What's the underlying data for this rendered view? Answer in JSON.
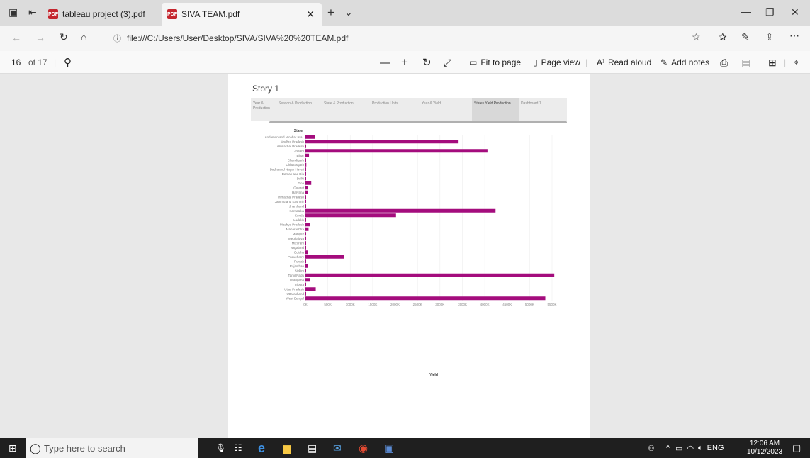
{
  "tabs": [
    {
      "label": "tableau project (3).pdf",
      "active": false
    },
    {
      "label": "SIVA TEAM.pdf",
      "active": true
    }
  ],
  "address": "file:///C:/Users/User/Desktop/SIVA/SIVA%20%20TEAM.pdf",
  "toolbar": {
    "page_number": "16",
    "page_total": "of 17",
    "fit_to_page": "Fit to page",
    "page_view": "Page view",
    "read_aloud": "Read aloud",
    "add_notes": "Add notes"
  },
  "story": {
    "title": "Story 1",
    "nav": [
      "Year & Production",
      "Season & Production",
      "State & Production",
      "Production Units",
      "Year & Yield",
      "States Yield Production",
      "Dashboard 1"
    ],
    "selected_index": 5
  },
  "chart_data": {
    "type": "bar",
    "orientation": "horizontal",
    "title": "",
    "ylabel": "State",
    "xlabel": "Yield",
    "xlim": [
      0,
      5500000
    ],
    "tick_labels": [
      "0K",
      "500K",
      "1000K",
      "1500K",
      "2000K",
      "2500K",
      "3000K",
      "3500K",
      "4000K",
      "4500K",
      "5000K",
      "5500K"
    ],
    "bar_color": "#a40c7d",
    "categories": [
      "Andaman and Nicobar Isla..",
      "Andhra Pradesh",
      "Arunachal Pradesh",
      "Assam",
      "Bihar",
      "Chandigarh",
      "Chhattisgarh",
      "Dadra and Nagar Haveli",
      "Daman and Diu",
      "Delhi",
      "Goa",
      "Gujarat",
      "Haryana",
      "Himachal Pradesh",
      "Jammu and Kashmir",
      "Jharkhand",
      "Karnataka",
      "Kerala",
      "Ladakh",
      "Madhya Pradesh",
      "Maharashtra",
      "Manipur",
      "Meghalaya",
      "Mizoram",
      "Nagaland",
      "Odisha",
      "Puducherry",
      "Punjab",
      "Rajasthan",
      "Sikkim",
      "Tamil Nadu",
      "Telangana",
      "Tripura",
      "Uttar Pradesh",
      "Uttarakhand",
      "West Bengal"
    ],
    "values": [
      210000,
      3400000,
      5000,
      4060000,
      80000,
      5000,
      20000,
      5000,
      5000,
      5000,
      130000,
      60000,
      60000,
      10000,
      10000,
      10000,
      4240000,
      2020000,
      5000,
      100000,
      70000,
      5000,
      5000,
      5000,
      5000,
      50000,
      860000,
      10000,
      50000,
      5000,
      5550000,
      100000,
      10000,
      230000,
      10000,
      5350000
    ]
  },
  "taskbar": {
    "search_placeholder": "Type here to search",
    "language": "ENG",
    "time": "12:06 AM",
    "date": "10/12/2023"
  }
}
